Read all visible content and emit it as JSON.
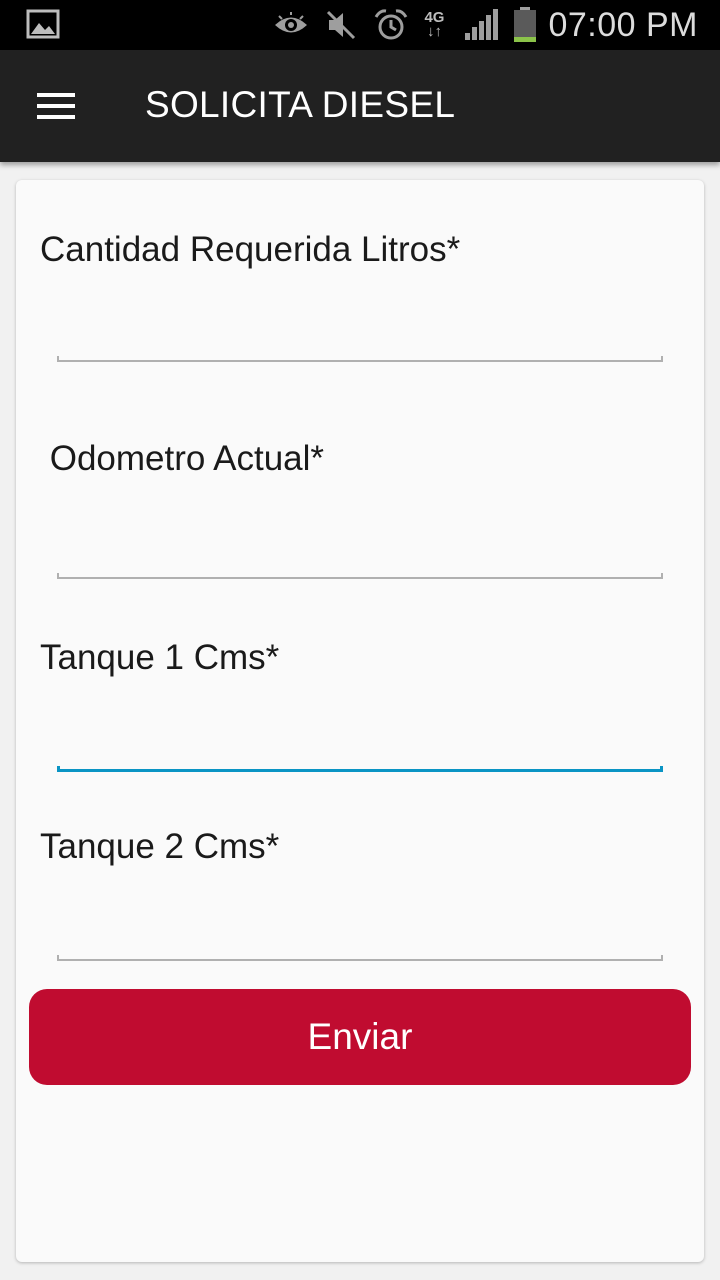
{
  "status_bar": {
    "time": "07:00 PM",
    "network": "4G",
    "icons": [
      "image-icon",
      "eye-icon",
      "mute-icon",
      "alarm-icon",
      "signal-icon",
      "battery-icon"
    ],
    "battery_color": "#8bc34a"
  },
  "app_bar": {
    "title": "SOLICITA DIESEL",
    "background": "#212121"
  },
  "form": {
    "fields": [
      {
        "label": "Cantidad Requerida Litros*",
        "value": ""
      },
      {
        "label": " Odometro Actual*",
        "value": ""
      },
      {
        "label": "Tanque 1 Cms*",
        "value": ""
      },
      {
        "label": "Tanque 2 Cms*",
        "value": ""
      }
    ],
    "submit_label": "Enviar",
    "accent_color": "#0a94c4",
    "button_color": "#c00c30"
  }
}
